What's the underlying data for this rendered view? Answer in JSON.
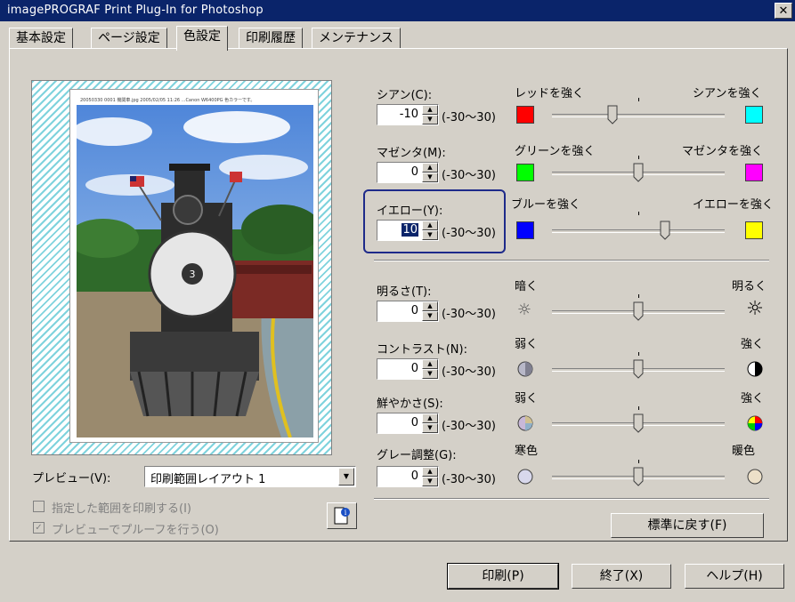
{
  "window": {
    "title": "imagePROGRAF Print Plug-In for Photoshop",
    "close_icon": "close-icon"
  },
  "tabs": [
    {
      "label": "基本設定",
      "active": false
    },
    {
      "label": "ページ設定",
      "active": false
    },
    {
      "label": "色設定",
      "active": true
    },
    {
      "label": "印刷履歴",
      "active": false
    },
    {
      "label": "メンテナンス",
      "active": false
    }
  ],
  "preview": {
    "paper_header": "20050330 0001 機関車.jpg 2005/02/05 11:26 ...Canon W6400PG 色カラーです。",
    "label": "プレビュー(V):",
    "layout_value": "印刷範囲レイアウト 1",
    "print_selection": "指定した範囲を印刷する(I)",
    "print_selection_checked": false,
    "preview_proof": "プレビューでプルーフを行う(O)",
    "preview_proof_checked": true,
    "info_icon": "page-info-icon"
  },
  "colors": {
    "cyan": {
      "label": "シアン(C):",
      "value": "-10",
      "range": "(-30〜30)",
      "left_label": "レッドを強く",
      "right_label": "シアンを強く",
      "left_color": "#ff0000",
      "right_color": "#00ffff"
    },
    "magenta": {
      "label": "マゼンタ(M):",
      "value": "0",
      "range": "(-30〜30)",
      "left_label": "グリーンを強く",
      "right_label": "マゼンタを強く",
      "left_color": "#00ff00",
      "right_color": "#ff00ff"
    },
    "yellow": {
      "label": "イエロー(Y):",
      "value": "10",
      "range": "(-30〜30)",
      "left_label": "ブルーを強く",
      "right_label": "イエローを強く",
      "left_color": "#0000ff",
      "right_color": "#ffff00"
    }
  },
  "adjust": {
    "brightness": {
      "label": "明るさ(T):",
      "value": "0",
      "range": "(-30〜30)",
      "left_label": "暗く",
      "right_label": "明るく",
      "left_icon": "dim-sun-icon",
      "right_icon": "bright-sun-icon"
    },
    "contrast": {
      "label": "コントラスト(N):",
      "value": "0",
      "range": "(-30〜30)",
      "left_label": "弱く",
      "right_label": "強く",
      "left_icon": "low-contrast-icon",
      "right_icon": "high-contrast-icon"
    },
    "saturation": {
      "label": "鮮やかさ(S):",
      "value": "0",
      "range": "(-30〜30)",
      "left_label": "弱く",
      "right_label": "強く",
      "left_icon": "low-saturation-icon",
      "right_icon": "high-saturation-icon"
    },
    "gray": {
      "label": "グレー調整(G):",
      "value": "0",
      "range": "(-30〜30)",
      "left_label": "寒色",
      "right_label": "暖色",
      "left_icon": "cool-tone-icon",
      "right_icon": "warm-tone-icon"
    }
  },
  "buttons": {
    "reset": "標準に戻す(F)",
    "print": "印刷(P)",
    "exit": "終了(X)",
    "help": "ヘルプ(H)"
  }
}
